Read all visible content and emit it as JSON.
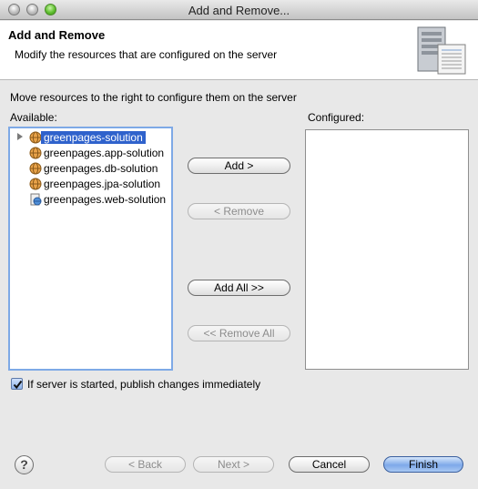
{
  "window": {
    "title": "Add and Remove..."
  },
  "header": {
    "title": "Add and Remove",
    "description": "Modify the resources that are configured on the server"
  },
  "instruction": "Move resources to the right to configure them on the server",
  "available": {
    "label": "Available:",
    "items": [
      {
        "label": "greenpages-solution",
        "selected": true,
        "expandable": true,
        "icon": "globe-icon"
      },
      {
        "label": "greenpages.app-solution",
        "icon": "globe-icon"
      },
      {
        "label": "greenpages.db-solution",
        "icon": "globe-icon"
      },
      {
        "label": "greenpages.jpa-solution",
        "icon": "globe-icon"
      },
      {
        "label": "greenpages.web-solution",
        "icon": "web-project-icon"
      }
    ]
  },
  "configured": {
    "label": "Configured:",
    "items": []
  },
  "buttons": {
    "add": "Add >",
    "remove": "< Remove",
    "add_all": "Add All >>",
    "remove_all": "<< Remove All",
    "back": "< Back",
    "next": "Next >",
    "cancel": "Cancel",
    "finish": "Finish",
    "help": "?"
  },
  "publish_option": {
    "label": "If server is started, publish changes immediately",
    "checked": true
  },
  "colors": {
    "selection": "#2f62cc",
    "default_button": "#7ea9e9"
  }
}
